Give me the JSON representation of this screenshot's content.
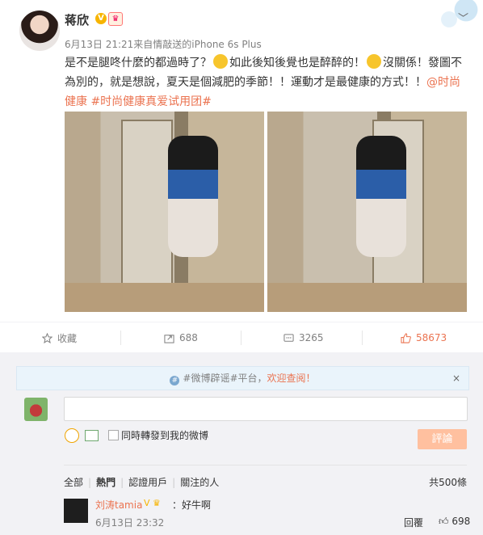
{
  "post": {
    "author": "蒋欣",
    "meta": "6月13日 21:21来自情敲送的iPhone 6s Plus",
    "text_segments": [
      "是不是腿咚什麼的都過時了？",
      "如此後知後覺也是醉醉的！",
      "沒關係！發圖不為別的，就是想說，夏天是個減肥的季節！！運動才是最健康的方式！！"
    ],
    "link_text": "@时尚健康 #时尚健康真爱试用团#"
  },
  "actions": {
    "favorite_label": "收藏",
    "repost_count": "688",
    "comment_count": "3265",
    "like_count": "58673"
  },
  "notice": {
    "prefix": "#微博辟谣#平台，",
    "highlight": "欢迎查阅！",
    "close": "×"
  },
  "composer": {
    "placeholder": "",
    "also_repost_label": "同時轉發到我的微博",
    "submit_label": "評論"
  },
  "filters": {
    "all": "全部",
    "hot": "熱門",
    "verified": "認證用戶",
    "following": "關注的人",
    "total": "共500條"
  },
  "comment": {
    "author": "刘涛tamia",
    "text": "：好牛啊",
    "time": "6月13日 23:32",
    "reply": "回覆",
    "likes": "698"
  },
  "colors": {
    "accent": "#eb7350",
    "badge": "#f7b400",
    "comment_bg": "#f2f2f5"
  }
}
